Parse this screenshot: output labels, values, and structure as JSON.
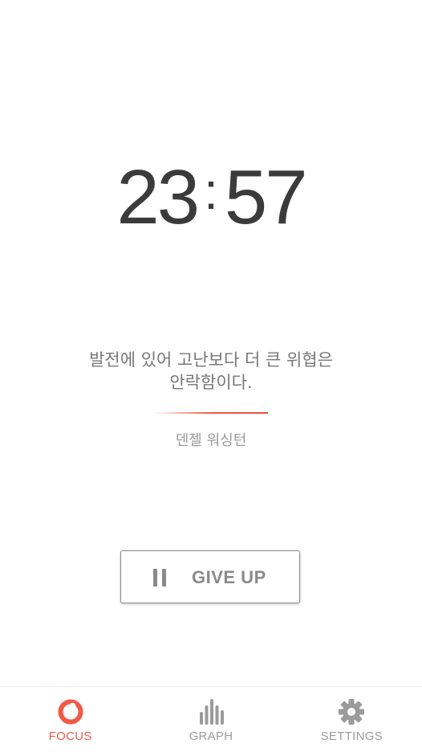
{
  "timer": {
    "minutes": "23",
    "separator": ":",
    "seconds": "57"
  },
  "quote": {
    "text_line1": "발전에 있어 고난보다 더 큰 위협은",
    "text_line2": "안락함이다.",
    "author": "덴젤 워싱턴"
  },
  "actions": {
    "give_up_label": "GIVE UP",
    "give_up_icon": "pause-icon"
  },
  "nav": {
    "items": [
      {
        "label": "FOCUS",
        "icon": "focus-icon",
        "active": true
      },
      {
        "label": "GRAPH",
        "icon": "bar-chart-icon",
        "active": false
      },
      {
        "label": "SETTINGS",
        "icon": "gear-icon",
        "active": false
      }
    ]
  },
  "colors": {
    "accent": "#f05a46",
    "timer_text": "#3b3b3b",
    "muted": "#9b9b9b"
  }
}
